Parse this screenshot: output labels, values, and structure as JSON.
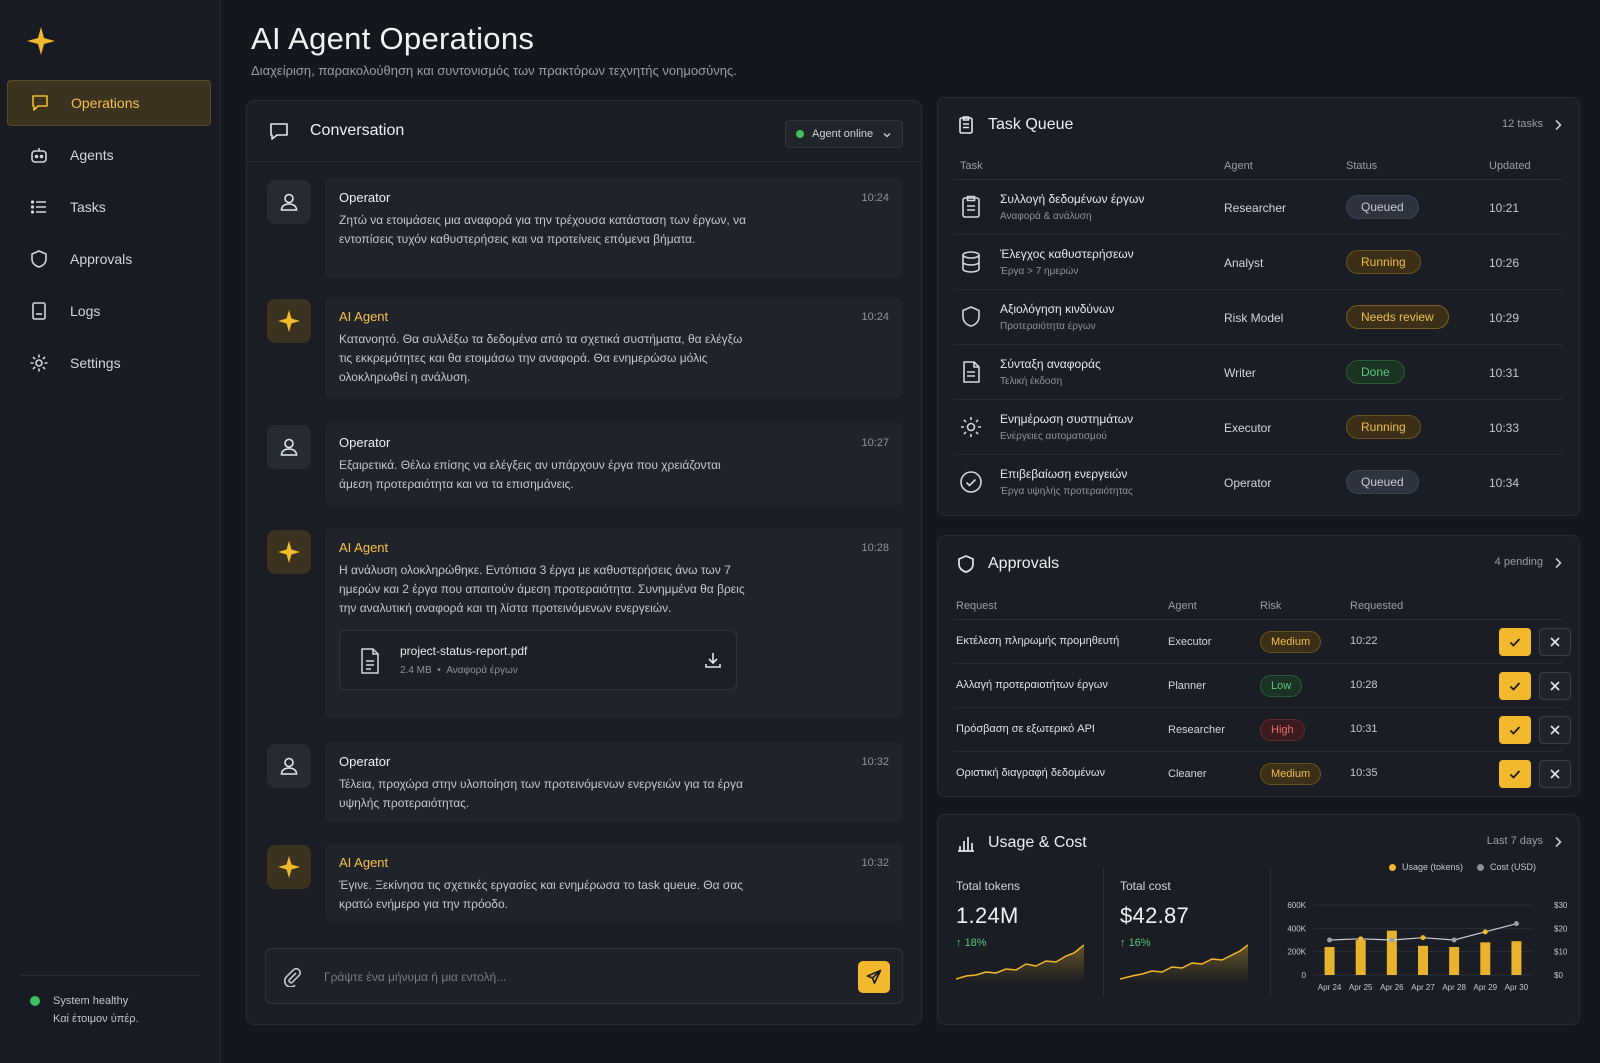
{
  "sidebar": {
    "items": [
      {
        "label": "Operations",
        "icon": "chat-icon"
      },
      {
        "label": "Agents",
        "icon": "robot-icon"
      },
      {
        "label": "Tasks",
        "icon": "list-icon"
      },
      {
        "label": "Approvals",
        "icon": "shield-icon"
      },
      {
        "label": "Logs",
        "icon": "log-file-icon"
      },
      {
        "label": "Settings",
        "icon": "gear-icon"
      }
    ],
    "status_title": "System healthy",
    "status_sub": "Καί έτοιμον ύπέρ."
  },
  "header": {
    "title": "AI Agent Operations",
    "subtitle": "Διαχείριση, παρακολούθηση και συντονισμός των πρακτόρων τεχνητής νοημοσύνης."
  },
  "conversation": {
    "title": "Conversation",
    "agent_status": "Agent online",
    "messages": [
      {
        "who": "Operator",
        "time": "10:24",
        "text": "Ζητώ να ετοιμάσεις μια αναφορά για την τρέχουσα κατάσταση των έργων, να εντοπίσεις τυχόν καθυστερήσεις και να προτείνεις επόμενα βήματα."
      },
      {
        "who": "AI Agent",
        "time": "10:24",
        "text": "Κατανοητό. Θα συλλέξω τα δεδομένα από τα σχετικά συστήματα, θα ελέγξω τις εκκρεμότητες και θα ετοιμάσω την αναφορά. Θα ενημερώσω μόλις ολοκληρωθεί η ανάλυση."
      },
      {
        "who": "Operator",
        "time": "10:27",
        "text": "Εξαιρετικά. Θέλω επίσης να ελέγξεις αν υπάρχουν έργα που χρειάζονται άμεση προτεραιότητα και να τα επισημάνεις."
      },
      {
        "who": "AI Agent",
        "time": "10:28",
        "text": "Η ανάλυση ολοκληρώθηκε. Εντόπισα 3 έργα με καθυστερήσεις άνω των 7 ημερών και 2 έργα που απαιτούν άμεση προτεραιότητα. Συνημμένα θα βρεις την αναλυτική αναφορά και τη λίστα προτεινόμενων ενεργειών."
      },
      {
        "who": "Operator",
        "time": "10:32",
        "text": "Τέλεια, προχώρα στην υλοποίηση των προτεινόμενων ενεργειών για τα έργα υψηλής προτεραιότητας."
      },
      {
        "who": "AI Agent",
        "time": "10:32",
        "text": "Έγινε. Ξεκίνησα τις σχετικές εργασίες και ενημέρωσα το task queue. Θα σας κρατώ ενήμερο για την πρόοδο."
      }
    ],
    "attachment": {
      "name": "project-status-report.pdf",
      "size": "2.4 MB",
      "desc": "Αναφορά έργων"
    },
    "composer_placeholder": "Γράψτε ένα μήνυμα ή μια εντολή..."
  },
  "task_queue": {
    "title": "Task Queue",
    "count": "12 tasks",
    "columns": [
      "Task",
      "Agent",
      "Status",
      "Updated"
    ],
    "rows": [
      {
        "icon": "clipboard-icon",
        "name": "Συλλογή δεδομένων έργων",
        "sub": "Αναφορά & ανάλυση",
        "agent": "Researcher",
        "status": "Queued",
        "status_kind": "queued",
        "updated": "10:21"
      },
      {
        "icon": "database-icon",
        "name": "Έλεγχος καθυστερήσεων",
        "sub": "Έργα > 7 ημερών",
        "agent": "Analyst",
        "status": "Running",
        "status_kind": "running",
        "updated": "10:26"
      },
      {
        "icon": "shield-icon",
        "name": "Αξιολόγηση κινδύνων",
        "sub": "Προτεραιότητα έργων",
        "agent": "Risk Model",
        "status": "Needs review",
        "status_kind": "review",
        "updated": "10:29"
      },
      {
        "icon": "document-icon",
        "name": "Σύνταξη αναφοράς",
        "sub": "Τελική έκδοση",
        "agent": "Writer",
        "status": "Done",
        "status_kind": "done",
        "updated": "10:31"
      },
      {
        "icon": "gear-icon",
        "name": "Ενημέρωση συστημάτων",
        "sub": "Ενέργειες αυτοματισμού",
        "agent": "Executor",
        "status": "Running",
        "status_kind": "running",
        "updated": "10:33"
      },
      {
        "icon": "check-circle-icon",
        "name": "Επιβεβαίωση ενεργειών",
        "sub": "Έργα υψηλής προτεραιότητας",
        "agent": "Operator",
        "status": "Queued",
        "status_kind": "queued",
        "updated": "10:34"
      }
    ]
  },
  "approvals": {
    "title": "Approvals",
    "count": "4 pending",
    "columns": [
      "Request",
      "Agent",
      "Risk",
      "Requested"
    ],
    "rows": [
      {
        "request": "Εκτέλεση πληρωμής προμηθευτή",
        "agent": "Executor",
        "risk": "Medium",
        "risk_kind": "medium",
        "time": "10:22"
      },
      {
        "request": "Αλλαγή προτεραιοτήτων έργων",
        "agent": "Planner",
        "risk": "Low",
        "risk_kind": "low",
        "time": "10:28"
      },
      {
        "request": "Πρόσβαση σε εξωτερικό API",
        "agent": "Researcher",
        "risk": "High",
        "risk_kind": "high",
        "time": "10:31"
      },
      {
        "request": "Οριστική διαγραφή δεδομένων",
        "agent": "Cleaner",
        "risk": "Medium",
        "risk_kind": "medium",
        "time": "10:35"
      }
    ]
  },
  "usage": {
    "title": "Usage & Cost",
    "range": "Last 7 days",
    "tokens_label": "Total tokens",
    "tokens_value": "1.24M",
    "tokens_change": "18%",
    "cost_label": "Total cost",
    "cost_value": "$42.87",
    "cost_change": "16%"
  },
  "colors": {
    "accent": "#f2b92e",
    "success": "#58c77b",
    "danger": "#ea6b6b",
    "background": "#14171d",
    "panel": "#1a1d23"
  },
  "chart_data": {
    "type": "bar",
    "categories": [
      "Apr 24",
      "Apr 25",
      "Apr 26",
      "Apr 27",
      "Apr 28",
      "Apr 29",
      "Apr 30"
    ],
    "series": [
      {
        "name": "Usage (tokens)",
        "values": [
          240000,
          300000,
          380000,
          250000,
          240000,
          280000,
          290000
        ],
        "axis": "left"
      },
      {
        "name": "Cost (USD)",
        "values": [
          15,
          15.5,
          15,
          16,
          15,
          18.5,
          22
        ],
        "axis": "right"
      }
    ],
    "y_left_ticks": [
      "600K",
      "400K",
      "200K",
      "0"
    ],
    "y_right_ticks": [
      "$30",
      "$20",
      "$10",
      "$0"
    ],
    "ylim_left": [
      0,
      600000
    ],
    "ylim_right": [
      0,
      30
    ],
    "legend": "top-right"
  }
}
